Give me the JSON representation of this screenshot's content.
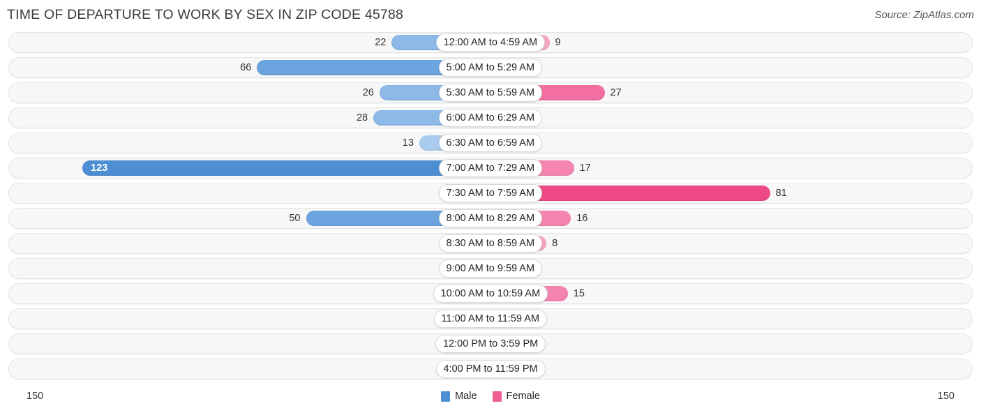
{
  "header": {
    "title": "TIME OF DEPARTURE TO WORK BY SEX IN ZIP CODE 45788",
    "source": "Source: ZipAtlas.com"
  },
  "legend": {
    "male_label": "Male",
    "female_label": "Female",
    "male_color": "#4e8fd4",
    "female_color": "#ef5e92"
  },
  "axis": {
    "left_max": "150",
    "right_max": "150"
  },
  "chart_data": {
    "type": "bar",
    "orientation": "horizontal-diverging",
    "title": "TIME OF DEPARTURE TO WORK BY SEX IN ZIP CODE 45788",
    "xlabel": "",
    "ylabel": "",
    "xlim": [
      150,
      150
    ],
    "grid": false,
    "legend_position": "bottom-center",
    "categories": [
      "12:00 AM to 4:59 AM",
      "5:00 AM to 5:29 AM",
      "5:30 AM to 5:59 AM",
      "6:00 AM to 6:29 AM",
      "6:30 AM to 6:59 AM",
      "7:00 AM to 7:29 AM",
      "7:30 AM to 7:59 AM",
      "8:00 AM to 8:29 AM",
      "8:30 AM to 8:59 AM",
      "9:00 AM to 9:59 AM",
      "10:00 AM to 10:59 AM",
      "11:00 AM to 11:59 AM",
      "12:00 PM to 3:59 PM",
      "4:00 PM to 11:59 PM"
    ],
    "series": [
      {
        "name": "Male",
        "color": "#4e8fd4",
        "values": [
          22,
          66,
          26,
          28,
          13,
          123,
          0,
          50,
          0,
          0,
          0,
          0,
          0,
          0
        ]
      },
      {
        "name": "Female",
        "color": "#ef5e92",
        "values": [
          9,
          0,
          27,
          0,
          0,
          17,
          81,
          16,
          8,
          0,
          15,
          0,
          0,
          0
        ]
      }
    ]
  },
  "rows": [
    {
      "label": "12:00 AM to 4:59 AM",
      "male": "22",
      "female": "9"
    },
    {
      "label": "5:00 AM to 5:29 AM",
      "male": "66",
      "female": "0"
    },
    {
      "label": "5:30 AM to 5:59 AM",
      "male": "26",
      "female": "27"
    },
    {
      "label": "6:00 AM to 6:29 AM",
      "male": "28",
      "female": "0"
    },
    {
      "label": "6:30 AM to 6:59 AM",
      "male": "13",
      "female": "0"
    },
    {
      "label": "7:00 AM to 7:29 AM",
      "male": "123",
      "female": "17"
    },
    {
      "label": "7:30 AM to 7:59 AM",
      "male": "0",
      "female": "81"
    },
    {
      "label": "8:00 AM to 8:29 AM",
      "male": "50",
      "female": "16"
    },
    {
      "label": "8:30 AM to 8:59 AM",
      "male": "0",
      "female": "8"
    },
    {
      "label": "9:00 AM to 9:59 AM",
      "male": "0",
      "female": "0"
    },
    {
      "label": "10:00 AM to 10:59 AM",
      "male": "0",
      "female": "15"
    },
    {
      "label": "11:00 AM to 11:59 AM",
      "male": "0",
      "female": "0"
    },
    {
      "label": "12:00 PM to 3:59 PM",
      "male": "0",
      "female": "0"
    },
    {
      "label": "4:00 PM to 11:59 PM",
      "male": "0",
      "female": "0"
    }
  ]
}
